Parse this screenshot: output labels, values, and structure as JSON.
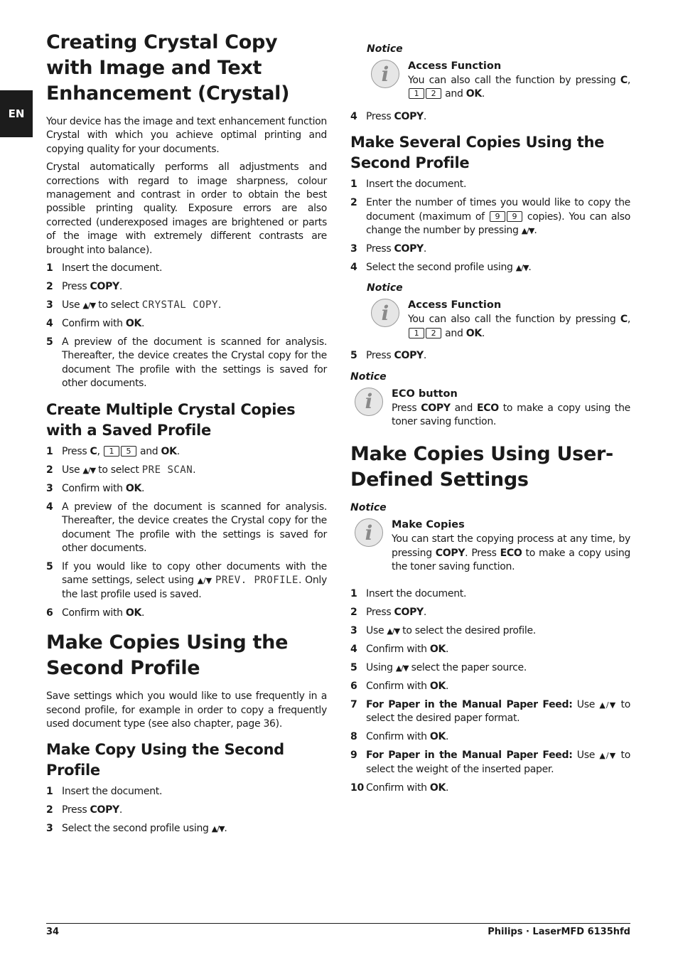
{
  "lang_tab": "EN",
  "left": {
    "h1_crystal": "Creating Crystal Copy with Image and Text Enhancement (Crystal)",
    "p1": "Your device has the image and text enhancement function Crystal with which you achieve optimal printing and copying quality for your documents.",
    "p2": "Crystal automatically performs all adjustments and corrections with regard to image sharpness, colour management and contrast in order to obtain the best possible printing quality. Exposure errors are also corrected (underexposed images are brightened or parts of the image with extremely different contrasts are brought into balance).",
    "crystal_steps": {
      "s1": {
        "num": "1",
        "text": "Insert the document."
      },
      "s2": {
        "num": "2",
        "pre": "Press ",
        "bold": "COPY",
        "post": "."
      },
      "s3": {
        "num": "3",
        "pre": "Use ",
        "arrows": "▲/▼",
        "mid": " to select ",
        "lcd": "CRYSTAL COPY",
        "post": "."
      },
      "s4": {
        "num": "4",
        "pre": "Confirm with ",
        "bold": "OK",
        "post": "."
      },
      "s5": {
        "num": "5",
        "text": "A preview of the document is scanned for analysis. Thereafter, the device creates the Crystal copy for the document The profile with the settings is saved for other documents."
      }
    },
    "h2_multiple": "Create Multiple Crystal Copies with a Saved Profile",
    "multiple_steps": {
      "s1": {
        "num": "1",
        "pre": "Press ",
        "bold": "C",
        "mid": ", ",
        "key1": "1",
        "key2": "5",
        "mid2": " and ",
        "bold2": "OK",
        "post": "."
      },
      "s2": {
        "num": "2",
        "pre": "Use ",
        "arrows": "▲/▼",
        "mid": " to select ",
        "lcd": "PRE SCAN",
        "post": "."
      },
      "s3": {
        "num": "3",
        "pre": "Confirm with ",
        "bold": "OK",
        "post": "."
      },
      "s4": {
        "num": "4",
        "text": "A preview of the document is scanned for analysis. Thereafter, the device creates the Crystal copy for the document The profile with the settings is saved for other documents."
      },
      "s5": {
        "num": "5",
        "pre": "If you would like to copy other documents with the same settings, select using ",
        "arrows": "▲/▼",
        "mid": " ",
        "lcd": "PREV. PROFILE",
        "post": ". Only the last profile used is saved."
      },
      "s6": {
        "num": "6",
        "pre": "Confirm with ",
        "bold": "OK",
        "post": "."
      }
    },
    "h1_second": "Make Copies Using the Second Profile",
    "p_second": "Save settings which you would like to use frequently in a second profile, for example in order to copy a frequently used document type (see also chapter, page 36).",
    "h2_make_copy": "Make Copy Using the Second Profile",
    "make_copy_steps": {
      "s1": {
        "num": "1",
        "text": "Insert the document."
      },
      "s2": {
        "num": "2",
        "pre": "Press ",
        "bold": "COPY",
        "post": "."
      },
      "s3": {
        "num": "3",
        "pre": "Select the second profile using ",
        "arrows": "▲/▼",
        "post": "."
      }
    }
  },
  "right": {
    "notice1": {
      "label": "Notice",
      "icon": "info-icon",
      "title": "Access Function",
      "pre": "You can also call the function by pressing ",
      "bold": "C",
      "mid": ", ",
      "key1": "1",
      "key2": "2",
      "mid2": " and ",
      "bold2": "OK",
      "post": "."
    },
    "step4": {
      "num": "4",
      "pre": "Press ",
      "bold": "COPY",
      "post": "."
    },
    "h2_several": "Make Several Copies Using the Second Profile",
    "several_steps": {
      "s1": {
        "num": "1",
        "text": "Insert the document."
      },
      "s2": {
        "num": "2",
        "pre": "Enter the number of times you would like to copy the document (maximum of ",
        "key1": "9",
        "key2": "9",
        "mid": " copies). You can also change the number by pressing ",
        "arrows": "▲/▼",
        "post": "."
      },
      "s3": {
        "num": "3",
        "pre": "Press ",
        "bold": "COPY",
        "post": "."
      },
      "s4": {
        "num": "4",
        "pre": "Select the second profile using ",
        "arrows": "▲/▼",
        "post": "."
      }
    },
    "notice2": {
      "label": "Notice",
      "icon": "info-icon",
      "title": "Access Function",
      "pre": "You can also call the function by pressing ",
      "bold": "C",
      "mid": ", ",
      "key1": "1",
      "key2": "2",
      "mid2": " and ",
      "bold2": "OK",
      "post": "."
    },
    "step5": {
      "num": "5",
      "pre": "Press ",
      "bold": "COPY",
      "post": "."
    },
    "notice3": {
      "label": "Notice",
      "icon": "info-icon",
      "title": "ECO button",
      "pre": "Press ",
      "bold": "COPY",
      "mid": " and ",
      "bold2": "ECO",
      "post": " to make a copy using the toner saving function."
    },
    "h1_user": "Make Copies Using User-Defined Settings",
    "notice4": {
      "label": "Notice",
      "icon": "info-icon",
      "title": "Make Copies",
      "pre": "You can start the copying process at any time, by pressing ",
      "bold": "COPY",
      "mid": ". Press ",
      "bold2": "ECO",
      "post": " to make a copy using the toner saving function."
    },
    "user_steps": {
      "s1": {
        "num": "1",
        "text": "Insert the document."
      },
      "s2": {
        "num": "2",
        "pre": "Press ",
        "bold": "COPY",
        "post": "."
      },
      "s3": {
        "num": "3",
        "pre": "Use ",
        "arrows": "▲/▼",
        "post": " to select the desired profile."
      },
      "s4": {
        "num": "4",
        "pre": "Confirm with ",
        "bold": "OK",
        "post": "."
      },
      "s5": {
        "num": "5",
        "pre": "Using ",
        "arrows": "▲/▼",
        "post": " select the paper source."
      },
      "s6": {
        "num": "6",
        "pre": "Confirm with ",
        "bold": "OK",
        "post": "."
      },
      "s7": {
        "num": "7",
        "bold": "For Paper in the Manual Paper Feed:",
        "pre": " Use ",
        "arrows": "▲/▼",
        "post": " to select the desired paper format."
      },
      "s8": {
        "num": "8",
        "pre": "Confirm with ",
        "bold": "OK",
        "post": "."
      },
      "s9": {
        "num": "9",
        "bold": "For Paper in the Manual Paper Feed:",
        "pre": " Use ",
        "arrows": "▲/▼",
        "post": " to select the weight of the inserted paper."
      },
      "s10": {
        "num": "10",
        "pre": "Confirm with ",
        "bold": "OK",
        "post": "."
      }
    }
  },
  "footer": {
    "page_number": "34",
    "product": "Philips · LaserMFD 6135hfd"
  }
}
